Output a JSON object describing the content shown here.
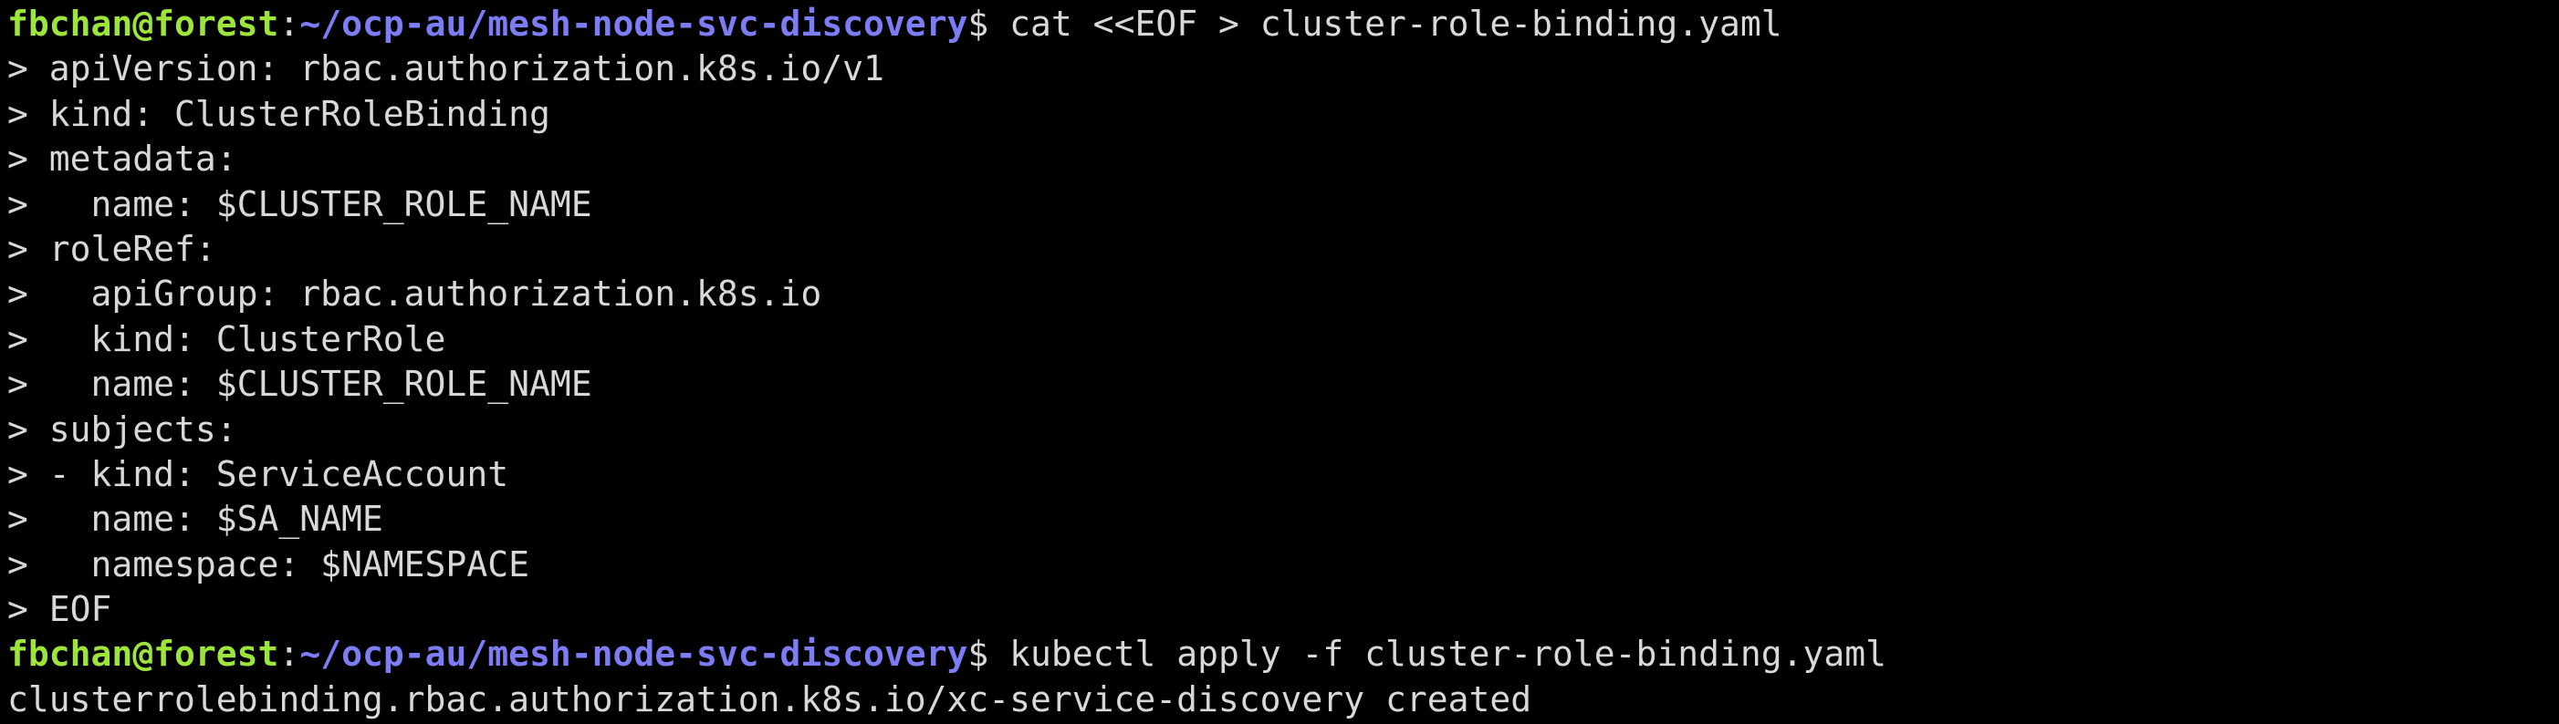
{
  "colors": {
    "background": "#000000",
    "text": "#d8d8d8",
    "prompt_user": "#9de53a",
    "prompt_path": "#7c7cf5"
  },
  "prompt1": {
    "user_host": "fbchan@forest",
    "sep": ":",
    "path": "~/ocp-au/mesh-node-svc-discovery",
    "symbol": "$",
    "command": " cat <<EOF > cluster-role-binding.yaml"
  },
  "heredoc_lines": [
    "> apiVersion: rbac.authorization.k8s.io/v1",
    "> kind: ClusterRoleBinding",
    "> metadata:",
    ">   name: $CLUSTER_ROLE_NAME",
    "> roleRef:",
    ">   apiGroup: rbac.authorization.k8s.io",
    ">   kind: ClusterRole",
    ">   name: $CLUSTER_ROLE_NAME",
    "> subjects:",
    "> - kind: ServiceAccount",
    ">   name: $SA_NAME",
    ">   namespace: $NAMESPACE",
    "> EOF"
  ],
  "prompt2": {
    "user_host": "fbchan@forest",
    "sep": ":",
    "path": "~/ocp-au/mesh-node-svc-discovery",
    "symbol": "$",
    "command": " kubectl apply -f cluster-role-binding.yaml"
  },
  "output_line": "clusterrolebinding.rbac.authorization.k8s.io/xc-service-discovery created"
}
